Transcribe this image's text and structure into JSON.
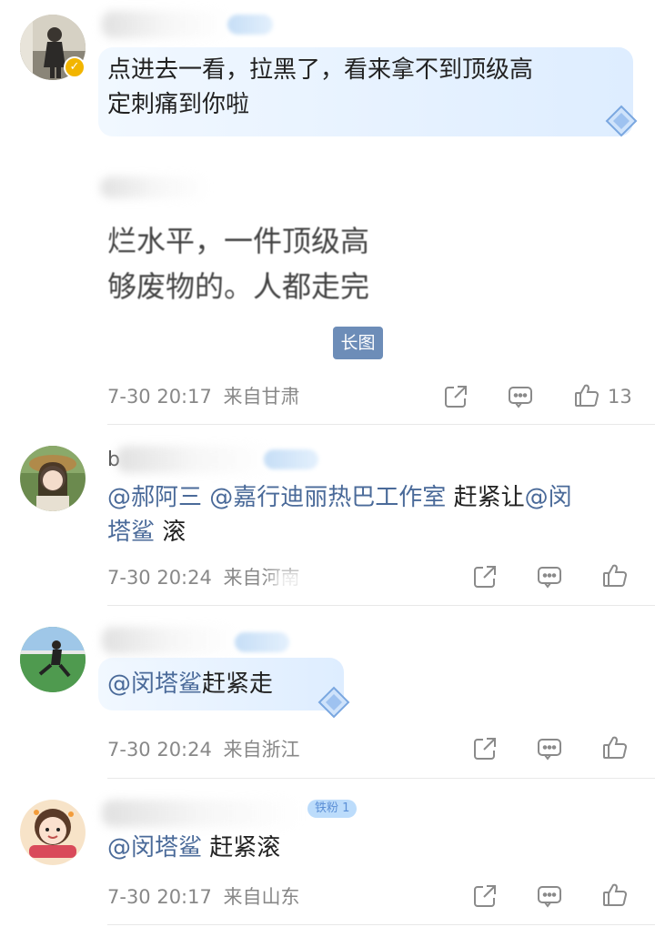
{
  "comments": [
    {
      "text": "点进去一看，拉黑了，看来拿不到顶级高定刺痛到你啦",
      "text_line1": "点进去一看，拉黑了，看来拿不到顶级高",
      "text_line2": "定刺痛到你啦",
      "badge": "铁粉 5",
      "quote_line1": "烂水平，一件顶级高",
      "quote_line2": "够废物的。人都走完",
      "long_image_label": "长图",
      "time": "7-30 20:17",
      "location": "来自甘肃",
      "likes": "13"
    },
    {
      "username_partial": "b",
      "mentions": [
        "@郝阿三",
        "@嘉行迪丽热巴工作室"
      ],
      "text_after": "赶紧让",
      "mention_line": "@闵",
      "mention_line2": "塔鲨",
      "text_end": "滚",
      "time": "7-30 20:24",
      "location": "来自河南"
    },
    {
      "mention": "@闵塔鲨",
      "text": "赶紧走",
      "time": "7-30 20:24",
      "location": "来自浙江"
    },
    {
      "mention": "@闵塔鲨",
      "text": "赶紧滚",
      "badge": "铁粉 1",
      "time": "7-30 20:17",
      "location": "来自山东"
    }
  ],
  "icons": {
    "share": "share-icon",
    "comment": "comment-icon",
    "like": "like-icon",
    "verified": "verified-badge-icon",
    "crystal": "crystal-bubble-icon"
  },
  "colors": {
    "mention": "#4a6a99",
    "meta": "#888888",
    "bubble": "#dcecff",
    "long_image_tag": "#6d8db8"
  }
}
